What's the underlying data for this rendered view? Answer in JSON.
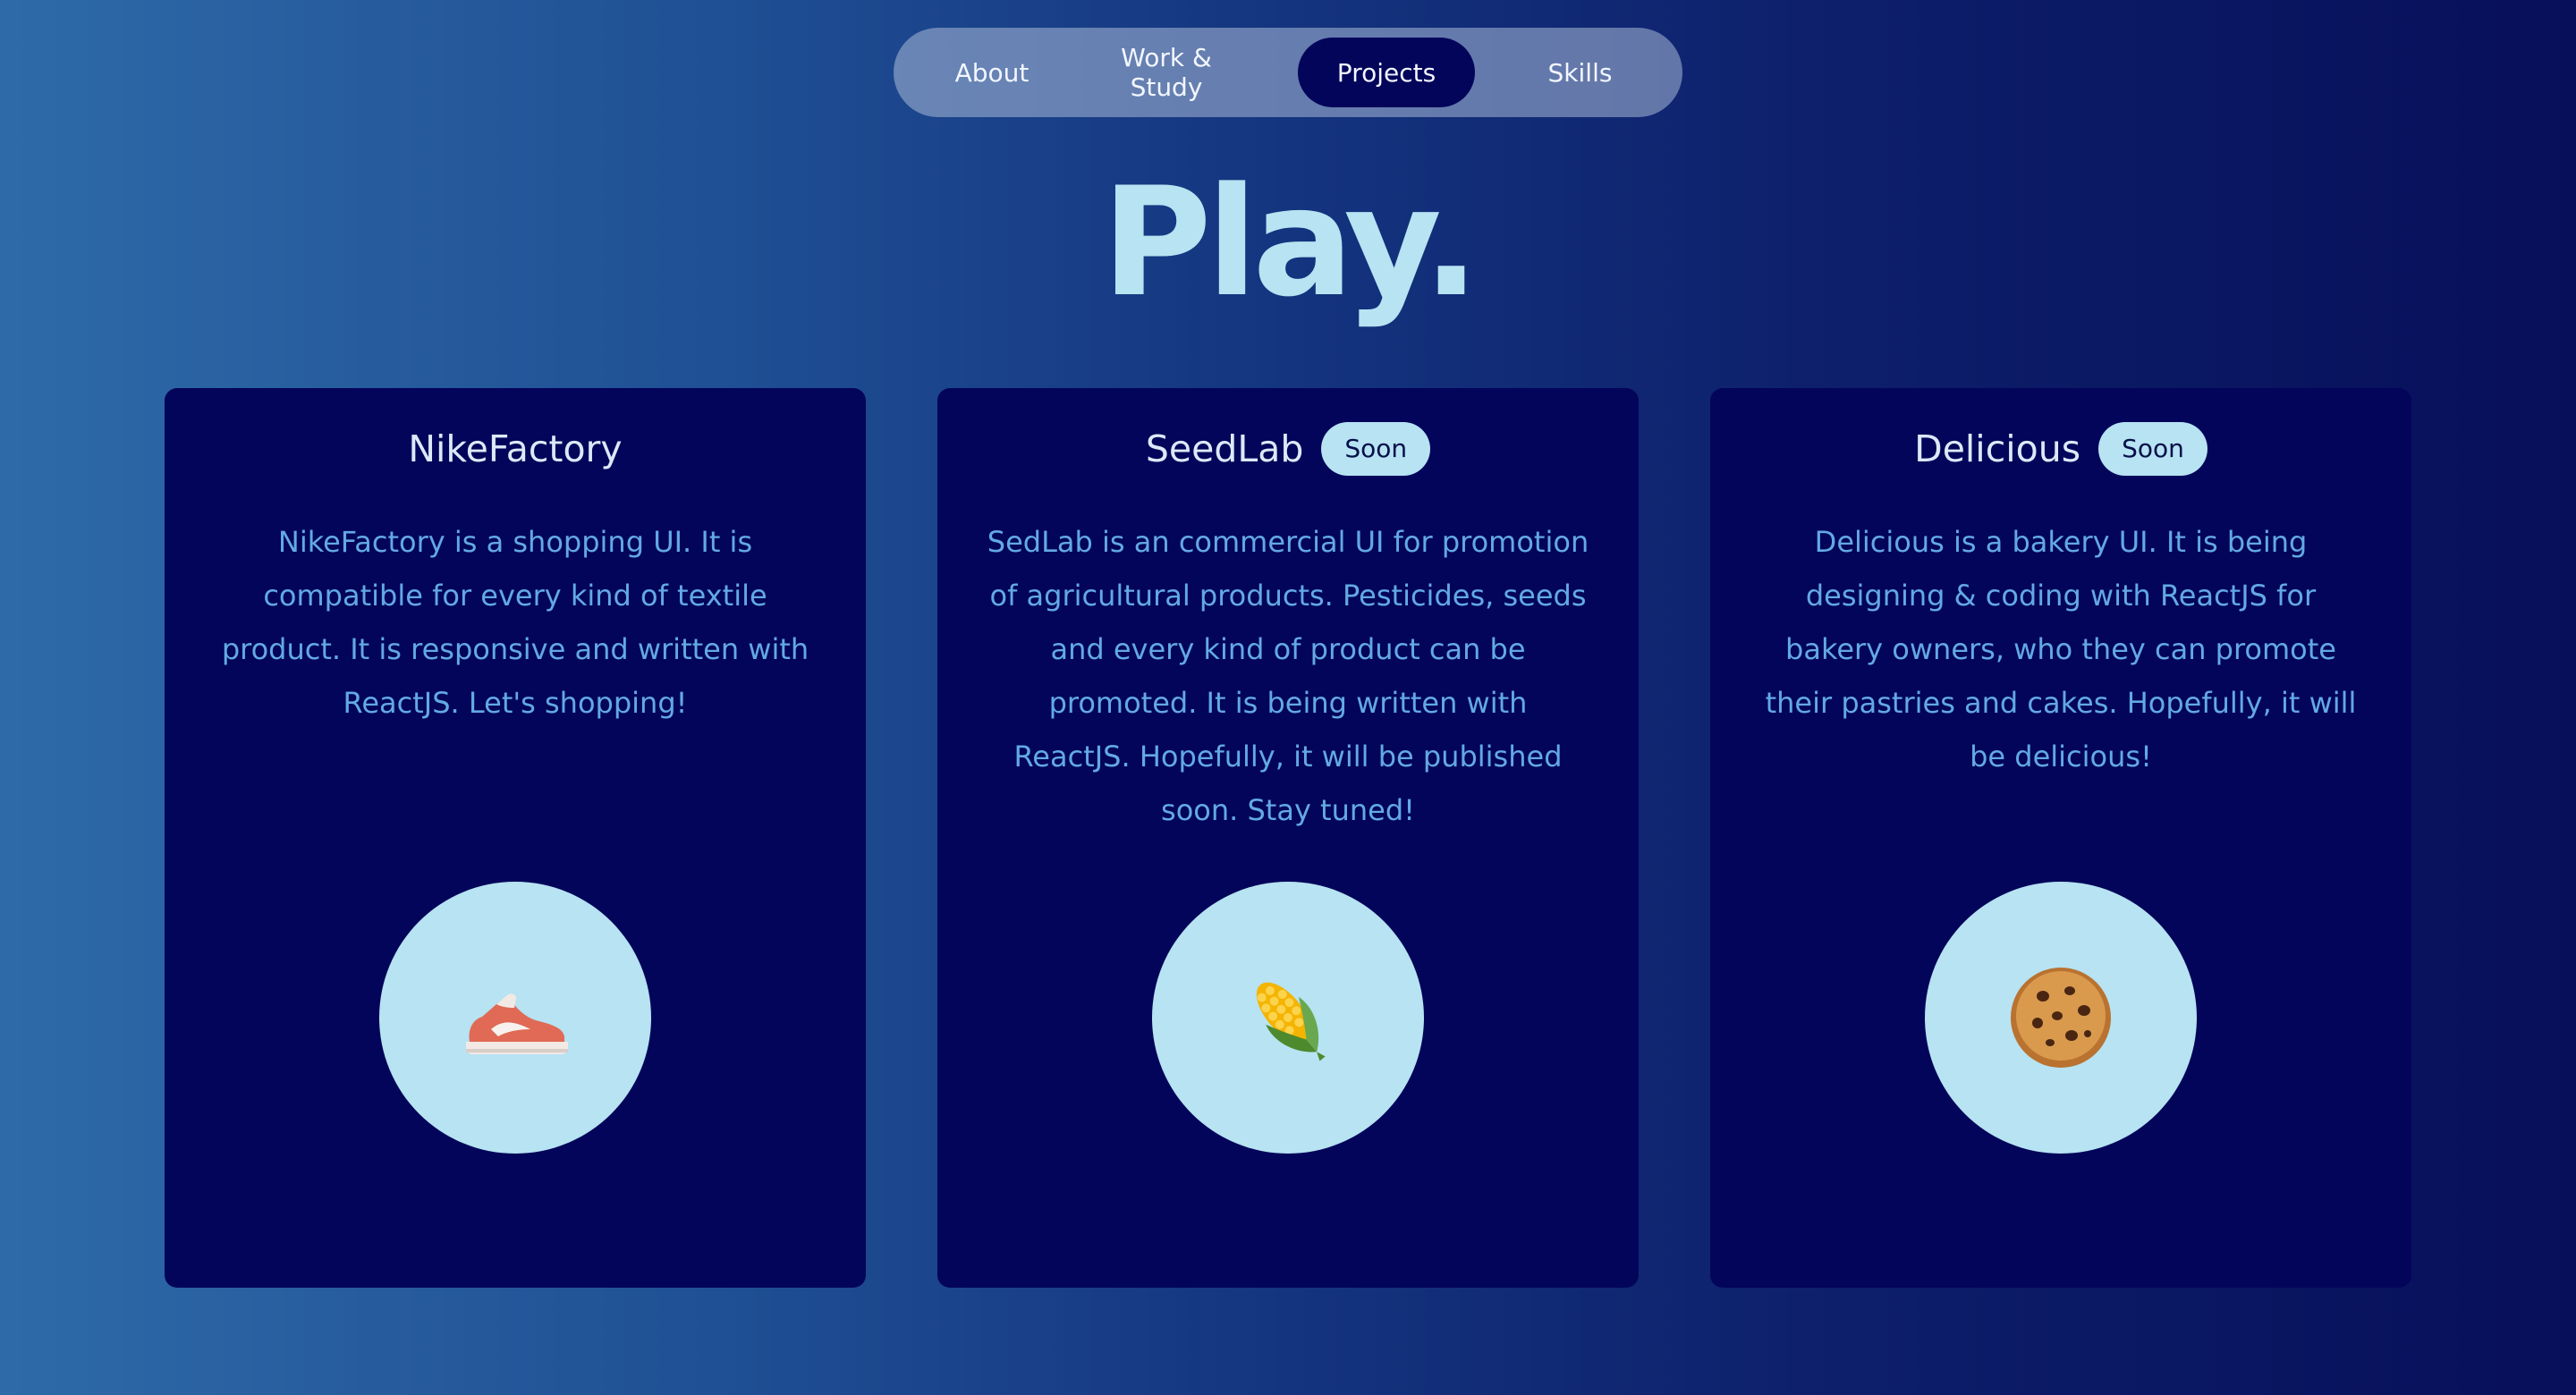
{
  "nav": {
    "items": [
      {
        "label": "About",
        "active": false
      },
      {
        "label": "Work &\nStudy",
        "active": false
      },
      {
        "label": "Projects",
        "active": true
      },
      {
        "label": "Skills",
        "active": false
      }
    ]
  },
  "hero": {
    "title": "Play."
  },
  "projects": [
    {
      "title": "NikeFactory",
      "badge": null,
      "description": "NikeFactory is a shopping UI. It is compatible for every kind of textile product. It is responsive and written with ReactJS. Let's shopping!",
      "icon": "sneaker-icon"
    },
    {
      "title": "SeedLab",
      "badge": "Soon",
      "description": "SedLab is an commercial UI for promotion of agricultural products. Pesticides, seeds and every kind of product can be promoted. It is being written with ReactJS. Hopefully, it will be published soon. Stay tuned!",
      "icon": "corn-icon"
    },
    {
      "title": "Delicious",
      "badge": "Soon",
      "description": "Delicious is a bakery UI. It is being designing & coding with ReactJS for bakery owners, who they can promote their pastries and cakes. Hopefully, it will be delicious!",
      "icon": "cookie-icon"
    }
  ],
  "colors": {
    "background_start": "#2e6aa8",
    "background_end": "#070f5a",
    "card": "#03055a",
    "accent": "#b7e3f2",
    "description_text": "#63a9e4"
  }
}
